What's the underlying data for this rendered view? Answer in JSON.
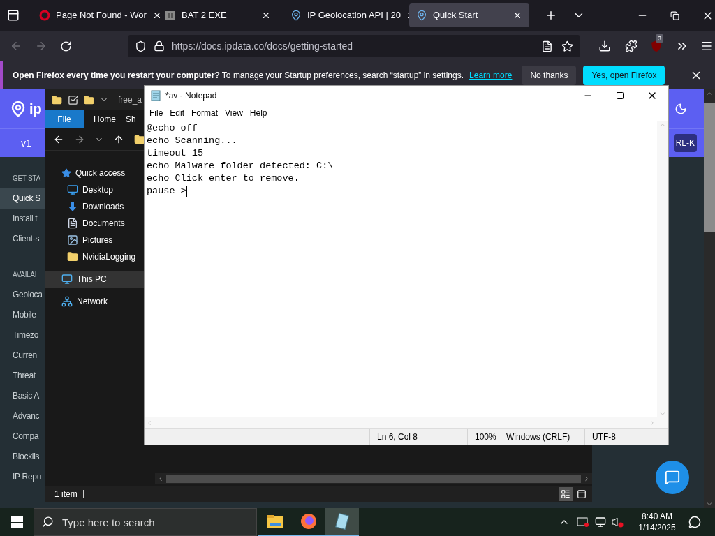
{
  "browser": {
    "tabs": [
      {
        "title": "Page Not Found - Wor",
        "selected": false
      },
      {
        "title": "BAT 2 EXE",
        "selected": false
      },
      {
        "title": "IP Geolocation API | 20",
        "selected": false
      },
      {
        "title": "Quick Start",
        "selected": true
      }
    ],
    "url": "https://docs.ipdata.co/docs/getting-started",
    "extension_badge": "3",
    "notification": {
      "message": "**Open Firefox every time you restart your computer?** To manage your Startup preferences, search “startup” in settings.",
      "link": "Learn more",
      "buttons": [
        "No thanks",
        "Yes, open Firefox"
      ]
    }
  },
  "webpage": {
    "logo_text": "ip",
    "version": "v1",
    "header_button": "RL-K",
    "sidebar": [
      {
        "kind": "heading",
        "label": "GET STA"
      },
      {
        "kind": "item",
        "label": "Quick S",
        "selected": true
      },
      {
        "kind": "item",
        "label": "Install t",
        "selected": false
      },
      {
        "kind": "item",
        "label": "Client-s",
        "selected": false
      },
      {
        "kind": "heading",
        "label": "AVAILAI"
      },
      {
        "kind": "item",
        "label": "Geoloca",
        "selected": false
      },
      {
        "kind": "item",
        "label": "Mobile",
        "selected": false
      },
      {
        "kind": "item",
        "label": "Timezo",
        "selected": false
      },
      {
        "kind": "item",
        "label": "Curren",
        "selected": false
      },
      {
        "kind": "item",
        "label": "Threat",
        "selected": false
      },
      {
        "kind": "item",
        "label": "Basic A",
        "selected": false
      },
      {
        "kind": "item",
        "label": "Advanc",
        "selected": false
      },
      {
        "kind": "item",
        "label": "Compa",
        "selected": false
      },
      {
        "kind": "item",
        "label": "Blocklis",
        "selected": false
      },
      {
        "kind": "item",
        "label": "IP Repu",
        "selected": false
      }
    ]
  },
  "explorer": {
    "title": "free_a",
    "ribbon_tabs": [
      {
        "label": "File",
        "selected": true
      },
      {
        "label": "Home",
        "selected": false
      },
      {
        "label": "Sh",
        "selected": false
      }
    ],
    "nav": [
      {
        "kind": "star",
        "label": "Quick access",
        "selected": false,
        "children": [
          {
            "kind": "desktop",
            "label": "Desktop",
            "selected": false
          },
          {
            "kind": "download",
            "label": "Downloads",
            "selected": false
          },
          {
            "kind": "document",
            "label": "Documents",
            "selected": false
          },
          {
            "kind": "picture",
            "label": "Pictures",
            "selected": false
          },
          {
            "kind": "folder",
            "label": "NvidiaLogging",
            "selected": false
          }
        ]
      },
      {
        "kind": "pc",
        "label": "This PC",
        "selected": true
      },
      {
        "kind": "network",
        "label": "Network",
        "selected": false
      }
    ],
    "status": "1 item"
  },
  "notepad": {
    "title": "*av - Notepad",
    "menu": [
      "File",
      "Edit",
      "Format",
      "View",
      "Help"
    ],
    "lines": [
      "@echo off",
      "echo Scanning...",
      "timeout 15",
      "echo Malware folder detected: C:\\",
      "echo Click enter to remove.",
      "pause >"
    ],
    "status": [
      "Ln 6, Col 8",
      "100%",
      "Windows (CRLF)",
      "UTF-8"
    ]
  },
  "taskbar": {
    "search_placeholder": "Type here to search",
    "apps": [
      {
        "kind": "explorer",
        "selected": false
      },
      {
        "kind": "firefox",
        "selected": false
      },
      {
        "kind": "notepad",
        "selected": true
      }
    ],
    "time": "8:40 AM",
    "date": "1/14/2025"
  }
}
